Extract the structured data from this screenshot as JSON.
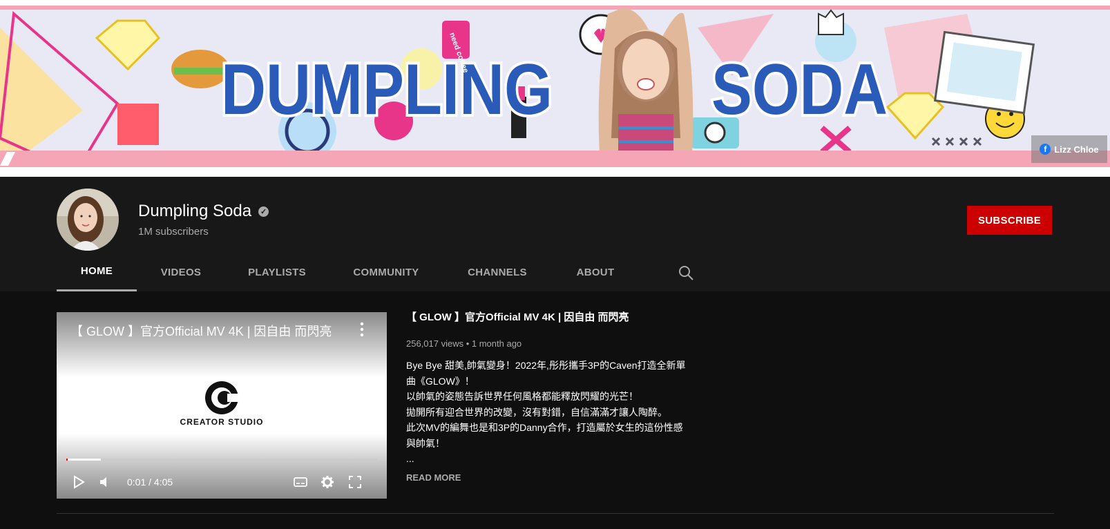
{
  "banner": {
    "logo_word_1": "DUMPLING",
    "logo_word_2": "SODA",
    "sticker_coffee": "need coffee",
    "social_link": "Lizz Chloe"
  },
  "channel": {
    "name": "Dumpling Soda",
    "subscribers": "1M subscribers",
    "subscribe_label": "SUBSCRIBE"
  },
  "tabs": [
    {
      "label": "HOME",
      "active": true
    },
    {
      "label": "VIDEOS",
      "active": false
    },
    {
      "label": "PLAYLISTS",
      "active": false
    },
    {
      "label": "COMMUNITY",
      "active": false
    },
    {
      "label": "CHANNELS",
      "active": false
    },
    {
      "label": "ABOUT",
      "active": false
    }
  ],
  "featured": {
    "player_title": "【 GLOW 】官方Official MV 4K | 因自由 而閃亮",
    "studio_text": "CREATOR STUDIO",
    "time": "0:01 / 4:05",
    "played_fraction": 0.004,
    "buffered_fraction": 0.11,
    "title": "【 GLOW 】官方Official MV 4K | 因自由 而閃亮",
    "meta": "256,017 views • 1 month ago",
    "description": [
      "Bye Bye 甜美,帥氣變身！2022年,彤彤攜手3P的Caven打造全新單",
      "曲《GLOW》！",
      "以帥氣的姿態告訴世界任何風格都能釋放閃耀的光芒！",
      "拋開所有迎合世界的改變，沒有對錯，自信滿滿才讓人陶醉。",
      "此次MV的編舞也是和3P的Danny合作，打造屬於女生的這份性感",
      "與帥氣！",
      "..."
    ],
    "read_more": "READ MORE"
  },
  "colors": {
    "subscribe_red": "#cc0000",
    "header_bg": "#181818",
    "page_bg": "#0f0f0f",
    "logo_blue": "#2a5bb8",
    "banner_pink": "#f4a6b6"
  }
}
